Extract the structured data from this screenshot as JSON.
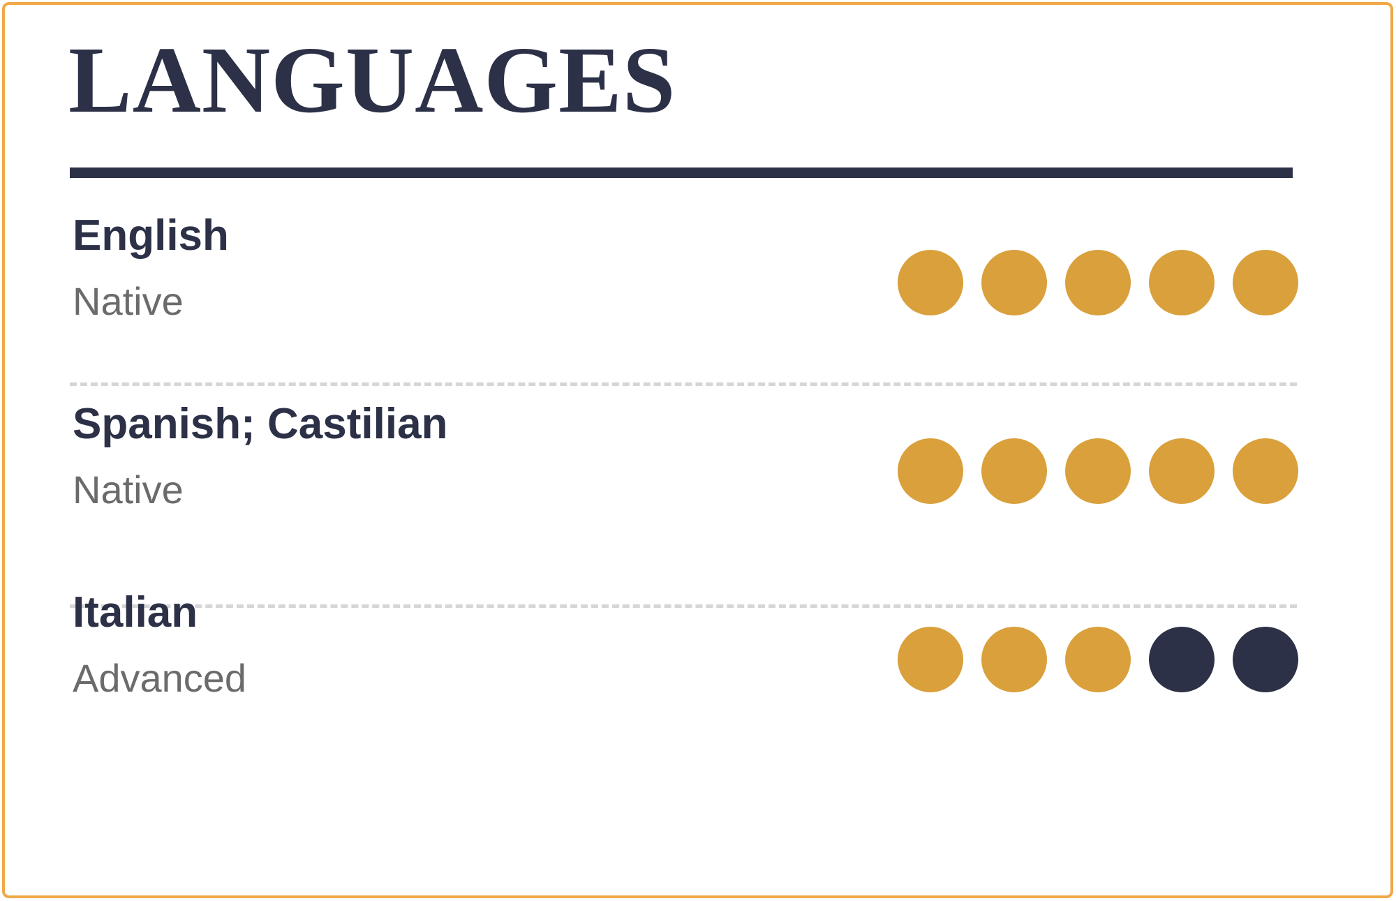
{
  "section": {
    "title": "LANGUAGES",
    "accent_color": "#d9a03c",
    "dark_color": "#2c3147",
    "muted_color": "#6b6b6b",
    "frame_color": "#f0a847",
    "separator_color": "#d6d6d6",
    "rating_max": 5
  },
  "languages": [
    {
      "name": "English",
      "level": "Native",
      "rating": 5,
      "dots": [
        "filled",
        "filled",
        "filled",
        "filled",
        "filled"
      ]
    },
    {
      "name": "Spanish; Castilian",
      "level": "Native",
      "rating": 5,
      "dots": [
        "filled",
        "filled",
        "filled",
        "filled",
        "filled"
      ]
    },
    {
      "name": "Italian",
      "level": "Advanced",
      "rating": 3,
      "dots": [
        "filled",
        "filled",
        "filled",
        "empty",
        "empty"
      ]
    }
  ]
}
